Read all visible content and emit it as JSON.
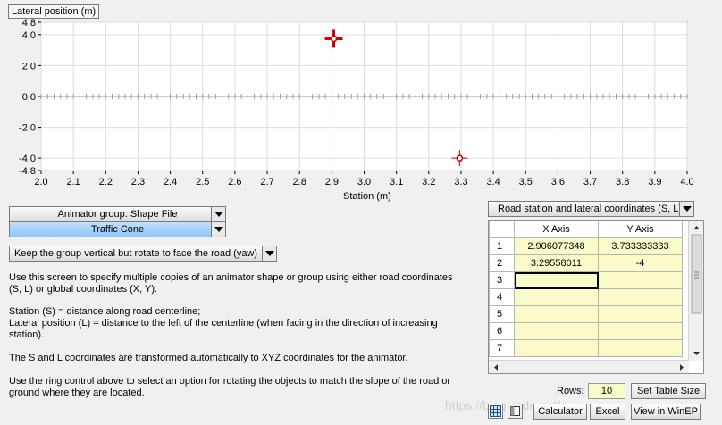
{
  "chart_data": {
    "type": "scatter",
    "ylabel": "Lateral position (m)",
    "xlabel": "Station (m)",
    "xlim": [
      2.0,
      4.0
    ],
    "ylim": [
      -4.8,
      4.8
    ],
    "x_ticks": [
      "2.0",
      "2.1",
      "2.2",
      "2.3",
      "2.4",
      "2.5",
      "2.6",
      "2.7",
      "2.8",
      "2.9",
      "3.0",
      "3.1",
      "3.2",
      "3.3",
      "3.4",
      "3.5",
      "3.6",
      "3.7",
      "3.8",
      "3.9",
      "4.0"
    ],
    "y_ticks": [
      "4.8",
      "4.0",
      "2.0",
      "0.0",
      "-2.0",
      "-4.0",
      "-4.8"
    ],
    "grid": true,
    "points": [
      {
        "x": 2.906077348,
        "y": 3.733333333,
        "style": "selected",
        "color": "#cc0000"
      },
      {
        "x": 3.29558011,
        "y": -4,
        "style": "normal",
        "color": "#cc0000"
      }
    ]
  },
  "controls": {
    "animator_group": "Animator group: Shape File",
    "shape": "Traffic Cone",
    "orientation": "Keep the group vertical but rotate to face the road (yaw)",
    "coord_mode": "Road station and lateral coordinates (S, L)"
  },
  "help": {
    "p1": "Use this screen to specify multiple copies of an animator shape or group using either road coordinates (S, L) or global coordinates (X, Y):",
    "p2a": "Station (S) = distance along road centerline;",
    "p2b": "Lateral position (L) = distance to the left of the centerline (when facing in the direction of increasing station).",
    "p3": "The S and L coordinates are transformed automatically to XYZ coordinates for the animator.",
    "p4": "Use the ring control above to select an option for  rotating the objects to match the slope of the road or ground where they are located."
  },
  "table": {
    "col_x": "X Axis",
    "col_y": "Y Axis",
    "rows": [
      {
        "n": "1",
        "x": "2.906077348",
        "y": "3.733333333"
      },
      {
        "n": "2",
        "x": "3.29558011",
        "y": "-4"
      },
      {
        "n": "3",
        "x": "",
        "y": ""
      },
      {
        "n": "4",
        "x": "",
        "y": ""
      },
      {
        "n": "5",
        "x": "",
        "y": ""
      },
      {
        "n": "6",
        "x": "",
        "y": ""
      },
      {
        "n": "7",
        "x": "",
        "y": ""
      }
    ]
  },
  "footer": {
    "rows_label": "Rows:",
    "rows_value": "10",
    "set_table_size": "Set Table Size",
    "calculator": "Calculator",
    "excel": "Excel",
    "view_winep": "View in WinEP",
    "watermark": "https://blog.csdn.net/"
  }
}
